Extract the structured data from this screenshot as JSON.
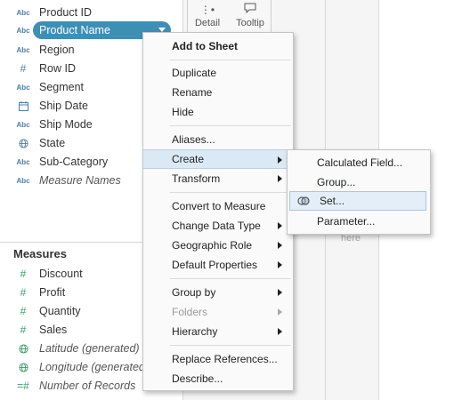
{
  "dimensions": [
    {
      "icon": "Abc",
      "label": "Product ID"
    },
    {
      "icon": "Abc",
      "label": "Product Name",
      "selected": true
    },
    {
      "icon": "Abc",
      "label": "Region"
    },
    {
      "icon": "#",
      "label": "Row ID"
    },
    {
      "icon": "Abc",
      "label": "Segment"
    },
    {
      "icon": "calendar",
      "label": "Ship Date"
    },
    {
      "icon": "Abc",
      "label": "Ship Mode"
    },
    {
      "icon": "globe",
      "label": "State"
    },
    {
      "icon": "Abc",
      "label": "Sub-Category"
    },
    {
      "icon": "Abc",
      "label": "Measure Names",
      "italic": true
    }
  ],
  "measures_title": "Measures",
  "measures": [
    {
      "icon": "#",
      "label": "Discount"
    },
    {
      "icon": "#",
      "label": "Profit"
    },
    {
      "icon": "#",
      "label": "Quantity"
    },
    {
      "icon": "#",
      "label": "Sales"
    },
    {
      "icon": "globe",
      "label": "Latitude (generated)",
      "italic": true
    },
    {
      "icon": "globe",
      "label": "Longitude (generated)",
      "italic": true
    },
    {
      "icon": "=#",
      "label": "Number of Records",
      "italic": true
    }
  ],
  "marks": {
    "detail_label": "Detail",
    "tooltip_label": "Tooltip"
  },
  "drop_hint": "here",
  "context_menu": {
    "add_to_sheet": "Add to Sheet",
    "duplicate": "Duplicate",
    "rename": "Rename",
    "hide": "Hide",
    "aliases": "Aliases...",
    "create": "Create",
    "transform": "Transform",
    "convert_to_measure": "Convert to Measure",
    "change_data_type": "Change Data Type",
    "geographic_role": "Geographic Role",
    "default_properties": "Default Properties",
    "group_by": "Group by",
    "folders": "Folders",
    "hierarchy": "Hierarchy",
    "replace_references": "Replace References...",
    "describe": "Describe..."
  },
  "create_submenu": {
    "calculated_field": "Calculated Field...",
    "group": "Group...",
    "set": "Set...",
    "parameter": "Parameter..."
  },
  "colors": {
    "selected_pill": "#3e8fb6",
    "highlight": "#dbe9f5"
  }
}
